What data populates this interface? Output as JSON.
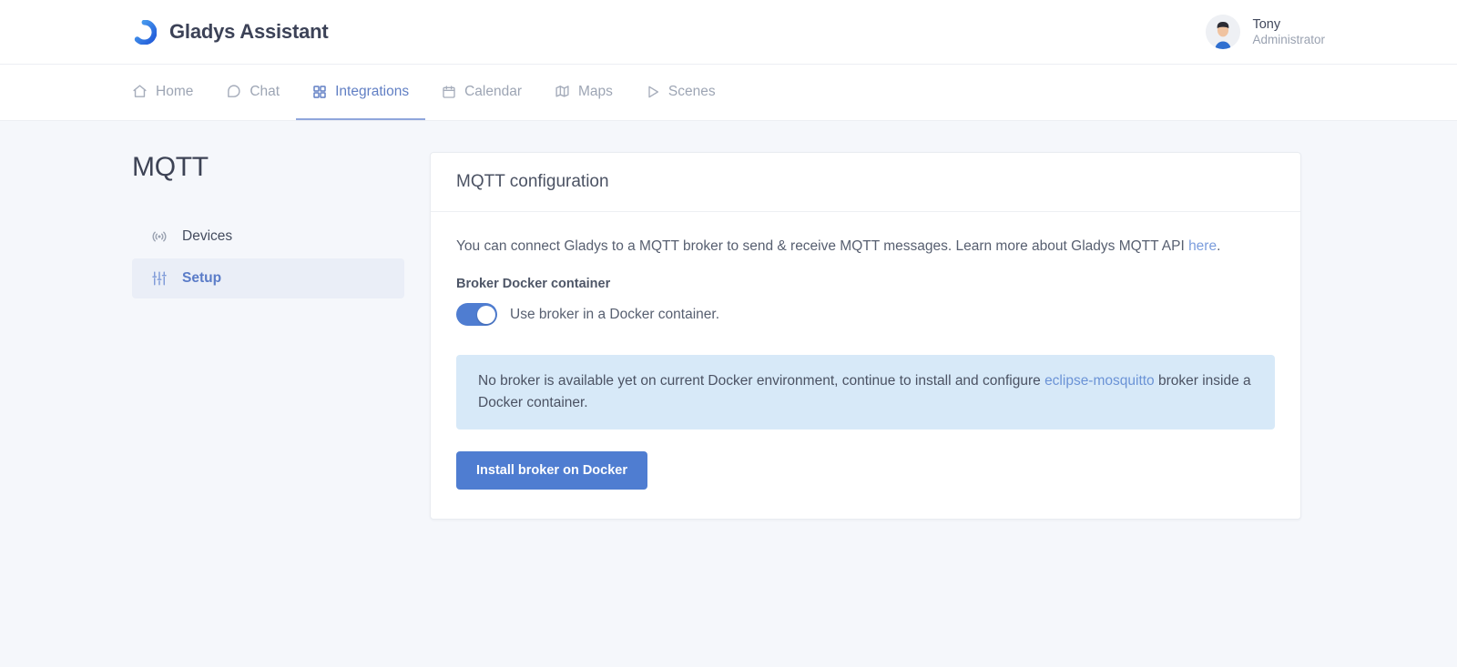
{
  "header": {
    "brand_title": "Gladys Assistant",
    "logo_icon": "gladys-ring-logo",
    "user": {
      "name": "Tony",
      "role": "Administrator",
      "avatar_icon": "user-avatar"
    }
  },
  "nav": {
    "tabs": [
      {
        "label": "Home",
        "icon": "home-icon",
        "active": false
      },
      {
        "label": "Chat",
        "icon": "chat-bubble-icon",
        "active": false
      },
      {
        "label": "Integrations",
        "icon": "grid-squares-icon",
        "active": true
      },
      {
        "label": "Calendar",
        "icon": "calendar-icon",
        "active": false
      },
      {
        "label": "Maps",
        "icon": "map-icon",
        "active": false
      },
      {
        "label": "Scenes",
        "icon": "play-triangle-icon",
        "active": false
      }
    ]
  },
  "sidebar": {
    "title": "MQTT",
    "items": [
      {
        "label": "Devices",
        "icon": "broadcast-icon",
        "active": false
      },
      {
        "label": "Setup",
        "icon": "sliders-icon",
        "active": true
      }
    ]
  },
  "card": {
    "title": "MQTT configuration",
    "intro": {
      "text_before": "You can connect Gladys to a MQTT broker to send & receive MQTT messages. Learn more about Gladys MQTT API ",
      "link_label": "here",
      "text_after": "."
    },
    "broker_section": {
      "label": "Broker Docker container",
      "toggle_label": "Use broker in a Docker container.",
      "toggle_state": "on"
    },
    "alert": {
      "text_before": "No broker is available yet on current Docker environment, continue to install and configure ",
      "link_label": "eclipse-mosquitto",
      "text_after": " broker inside a Docker container."
    },
    "install_button_label": "Install broker on Docker"
  },
  "colors": {
    "page_background": "#f5f7fb",
    "accent_blue": "#4f7dd1",
    "link_blue": "#7b9ddd",
    "alert_background": "#d7e9f8",
    "sidebar_active_background": "#eaeef7",
    "text_primary": "#4b5263",
    "text_muted": "#9aa2b1"
  }
}
